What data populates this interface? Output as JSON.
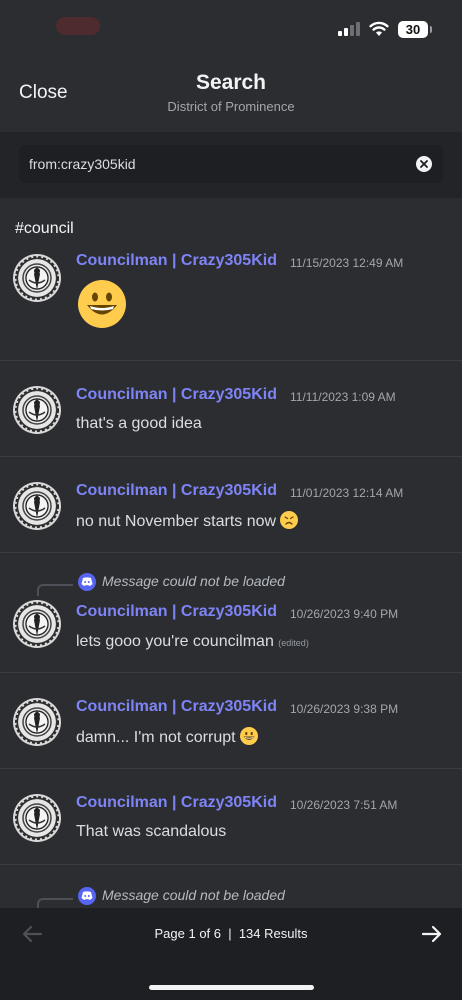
{
  "status_bar": {
    "battery": "30"
  },
  "header": {
    "close_label": "Close",
    "title": "Search",
    "subtitle": "District of Prominence"
  },
  "search": {
    "query": "from:crazy305kid"
  },
  "channel": "#council",
  "messages": [
    {
      "author": "Councilman | Crazy305Kid",
      "timestamp": "11/15/2023 12:49 AM",
      "content": "",
      "emoji": "grinning-face"
    },
    {
      "author": "Councilman | Crazy305Kid",
      "timestamp": "11/11/2023 1:09 AM",
      "content": "that's a good idea"
    },
    {
      "author": "Councilman | Crazy305Kid",
      "timestamp": "11/01/2023 12:14 AM",
      "content": "no nut November starts now",
      "emoji": "persevering-face"
    },
    {
      "author": "Councilman | Crazy305Kid",
      "timestamp": "10/26/2023 9:40 PM",
      "content": "lets gooo you're councilman",
      "edited": "(edited)",
      "reply": "Message could not be loaded"
    },
    {
      "author": "Councilman | Crazy305Kid",
      "timestamp": "10/26/2023 9:38 PM",
      "content": "damn... I'm not corrupt",
      "emoji": "grinning-face"
    },
    {
      "author": "Councilman | Crazy305Kid",
      "timestamp": "10/26/2023 7:51 AM",
      "content": "That was scandalous"
    }
  ],
  "trailing_reply": "Message could not be loaded",
  "footer": {
    "pagination": "Page 1 of 6  |  134 Results"
  },
  "colors": {
    "accent": "#7e84f6",
    "background": "#2b2d31",
    "discord_blurple": "#5865f2"
  }
}
